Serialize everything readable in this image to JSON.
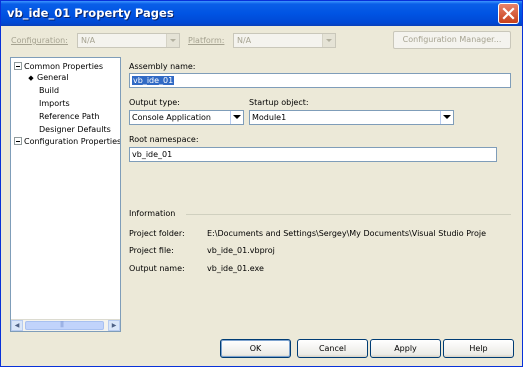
{
  "window": {
    "title": "vb_ide_01 Property Pages"
  },
  "toolbar": {
    "configuration_label": "Configuration:",
    "configuration_value": "N/A",
    "platform_label": "Platform:",
    "platform_value": "N/A",
    "configuration_manager_label": "Configuration Manager..."
  },
  "tree": {
    "items": [
      {
        "label": "Common Properties",
        "expanded": true
      },
      {
        "label": "General",
        "selected": true
      },
      {
        "label": "Build"
      },
      {
        "label": "Imports"
      },
      {
        "label": "Reference Path"
      },
      {
        "label": "Designer Defaults"
      },
      {
        "label": "Configuration Properties",
        "expanded": true
      }
    ]
  },
  "general": {
    "assembly_name_label": "Assembly name:",
    "assembly_name_value": "vb_ide_01",
    "output_type_label": "Output type:",
    "output_type_value": "Console Application",
    "startup_object_label": "Startup object:",
    "startup_object_value": "Module1",
    "root_namespace_label": "Root namespace:",
    "root_namespace_value": "vb_ide_01"
  },
  "information": {
    "heading": "Information",
    "project_folder_label": "Project folder:",
    "project_folder_value": "E:\\Documents and Settings\\Sergey\\My Documents\\Visual Studio Proje",
    "project_file_label": "Project file:",
    "project_file_value": "vb_ide_01.vbproj",
    "output_name_label": "Output name:",
    "output_name_value": "vb_ide_01.exe"
  },
  "buttons": {
    "ok": "OK",
    "cancel": "Cancel",
    "apply": "Apply",
    "help": "Help"
  }
}
